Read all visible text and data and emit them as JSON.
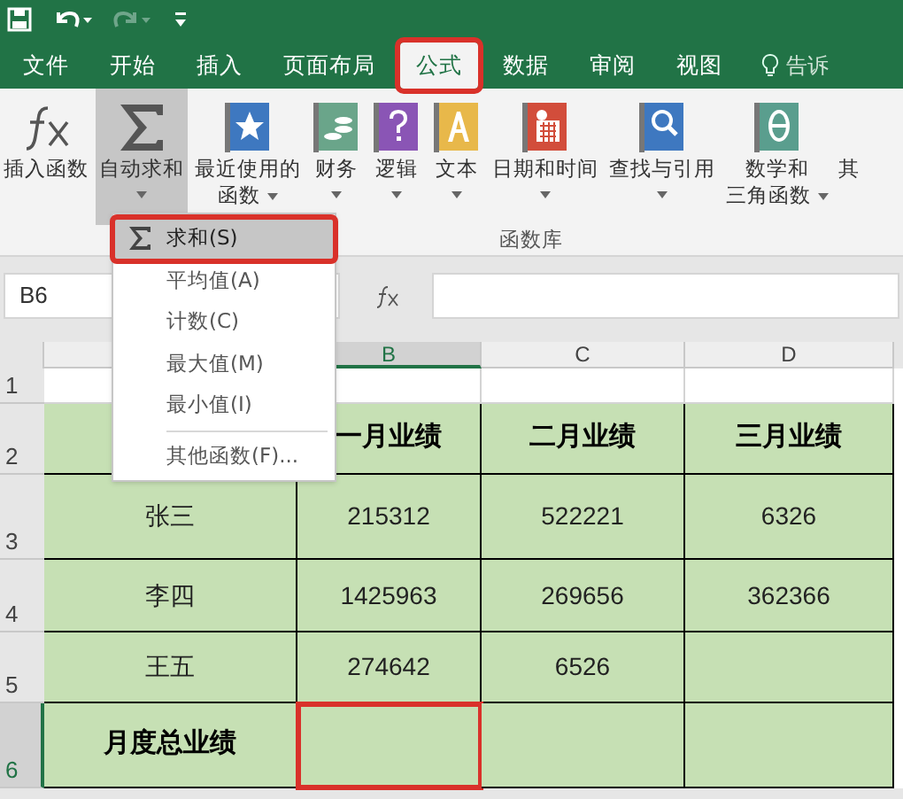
{
  "tabs": [
    {
      "label": "文件",
      "selected": false,
      "highlighted": false
    },
    {
      "label": "开始",
      "selected": false,
      "highlighted": false
    },
    {
      "label": "插入",
      "selected": false,
      "highlighted": false
    },
    {
      "label": "页面布局",
      "selected": false,
      "highlighted": false
    },
    {
      "label": "公式",
      "selected": true,
      "highlighted": true
    },
    {
      "label": "数据",
      "selected": false,
      "highlighted": false
    },
    {
      "label": "审阅",
      "selected": false,
      "highlighted": false
    },
    {
      "label": "视图",
      "selected": false,
      "highlighted": false
    }
  ],
  "tell_me": "告诉",
  "ribbon": {
    "buttons": [
      {
        "kind": "fx",
        "lines": [
          "插入函数"
        ],
        "dropdown": false,
        "pressed": false
      },
      {
        "kind": "sum",
        "lines": [
          "自动求和"
        ],
        "dropdown": true,
        "pressed": true
      },
      {
        "kind": "recent",
        "lines": [
          "最近使用的",
          "函数"
        ],
        "dropdown": true,
        "pressed": false
      },
      {
        "kind": "financial",
        "lines": [
          "财务"
        ],
        "dropdown": true,
        "pressed": false
      },
      {
        "kind": "logical",
        "lines": [
          "逻辑"
        ],
        "dropdown": true,
        "pressed": false
      },
      {
        "kind": "text",
        "lines": [
          "文本"
        ],
        "dropdown": true,
        "pressed": false
      },
      {
        "kind": "datetime",
        "lines": [
          "日期和时间"
        ],
        "dropdown": true,
        "pressed": false
      },
      {
        "kind": "lookup",
        "lines": [
          "查找与引用"
        ],
        "dropdown": true,
        "pressed": false
      },
      {
        "kind": "math",
        "lines": [
          "数学和",
          "三角函数"
        ],
        "dropdown": true,
        "pressed": false
      },
      {
        "kind": "other",
        "lines": [
          "其"
        ],
        "dropdown": false,
        "pressed": false
      }
    ],
    "group_label": "函数库"
  },
  "name_box": "B6",
  "menu": {
    "items": [
      {
        "kind": "item",
        "label": "求和(S)",
        "icon": true,
        "selected": true,
        "highlighted": true
      },
      {
        "kind": "item",
        "label": "平均值(A)",
        "icon": false,
        "selected": false,
        "highlighted": false
      },
      {
        "kind": "item",
        "label": "计数(C)",
        "icon": false,
        "selected": false,
        "highlighted": false
      },
      {
        "kind": "item",
        "label": "最大值(M)",
        "icon": false,
        "selected": false,
        "highlighted": false
      },
      {
        "kind": "item",
        "label": "最小值(I)",
        "icon": false,
        "selected": false,
        "highlighted": false
      },
      {
        "kind": "separator"
      },
      {
        "kind": "item",
        "label": "其他函数(F)...",
        "icon": false,
        "selected": false,
        "highlighted": false
      }
    ]
  },
  "sheet": {
    "columns": [
      {
        "selected": false
      },
      {
        "label": "B",
        "selected": true
      },
      {
        "label": "C",
        "selected": false
      },
      {
        "label": "D",
        "selected": false
      }
    ],
    "rows": [
      {
        "number": "1",
        "kind": "blank",
        "selected": false,
        "cells": [
          {},
          {},
          {},
          {}
        ]
      },
      {
        "number": "2",
        "kind": "header",
        "selected": false,
        "cells": [
          {},
          {
            "text": "一月业绩"
          },
          {
            "text": "二月业绩"
          },
          {
            "text": "三月业绩"
          }
        ]
      },
      {
        "number": "3",
        "kind": "data",
        "selected": false,
        "cells": [
          {
            "text": "张三"
          },
          {
            "text": "215312"
          },
          {
            "text": "522221"
          },
          {
            "text": "6326"
          }
        ]
      },
      {
        "number": "4",
        "kind": "data",
        "selected": false,
        "cells": [
          {
            "text": "李四"
          },
          {
            "text": "1425963"
          },
          {
            "text": "269656"
          },
          {
            "text": "362366"
          }
        ]
      },
      {
        "number": "5",
        "kind": "data",
        "selected": false,
        "cells": [
          {
            "text": "王五"
          },
          {
            "text": "274642"
          },
          {
            "text": "6526"
          },
          {}
        ]
      },
      {
        "number": "6",
        "kind": "total",
        "selected": true,
        "cells": [
          {
            "text": "月度总业绩"
          },
          {
            "highlighted": true
          },
          {},
          {}
        ]
      }
    ]
  }
}
